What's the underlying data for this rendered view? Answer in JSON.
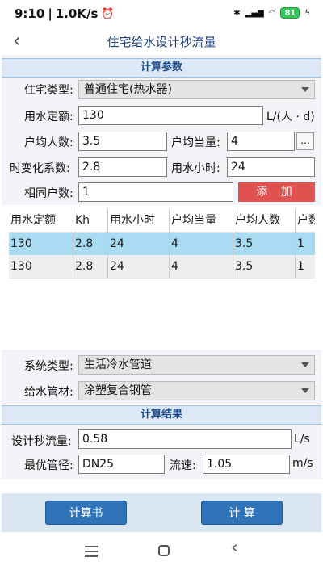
{
  "status": {
    "time": "9:10",
    "speed": "1.0K/s",
    "battery": "81"
  },
  "header": {
    "title": "住宅给水设计秒流量"
  },
  "params": {
    "section_title": "计算参数",
    "house_type_label": "住宅类型:",
    "house_type_value": "普通住宅(热水器)",
    "quota_label": "用水定额:",
    "quota_value": "130",
    "quota_unit": "L/(人 · d)",
    "avg_people_label": "户均人数:",
    "avg_people_value": "3.5",
    "avg_equiv_label": "户均当量:",
    "avg_equiv_value": "4",
    "equiv_btn": "...",
    "kh_label": "时变化系数:",
    "kh_value": "2.8",
    "hours_label": "用水小时:",
    "hours_value": "24",
    "same_label": "相同户数:",
    "same_value": "1",
    "add_btn": "添 加"
  },
  "table": {
    "headers": [
      "用水定额",
      "Kh",
      "用水小时",
      "户均当量",
      "户均人数",
      "户数"
    ],
    "rows": [
      [
        "130",
        "2.8",
        "24",
        "4",
        "3.5",
        "1"
      ],
      [
        "130",
        "2.8",
        "24",
        "4",
        "3.5",
        "1"
      ]
    ]
  },
  "system": {
    "sys_label": "系统类型:",
    "sys_value": "生活冷水管道",
    "pipe_label": "给水管材:",
    "pipe_value": "涂塑复合钢管"
  },
  "results": {
    "section_title": "计算结果",
    "flow_label": "设计秒流量:",
    "flow_value": "0.58",
    "flow_unit": "L/s",
    "dia_label": "最优管径:",
    "dia_value": "DN25",
    "speed_label": "流速:",
    "speed_value": "1.05",
    "speed_unit": "m/s"
  },
  "actions": {
    "book_btn": "计算书",
    "calc_btn": "计 算"
  },
  "colors": {
    "accent": "#2f74b8",
    "add": "#e0524f",
    "selected_row": "#a9dcf3"
  }
}
